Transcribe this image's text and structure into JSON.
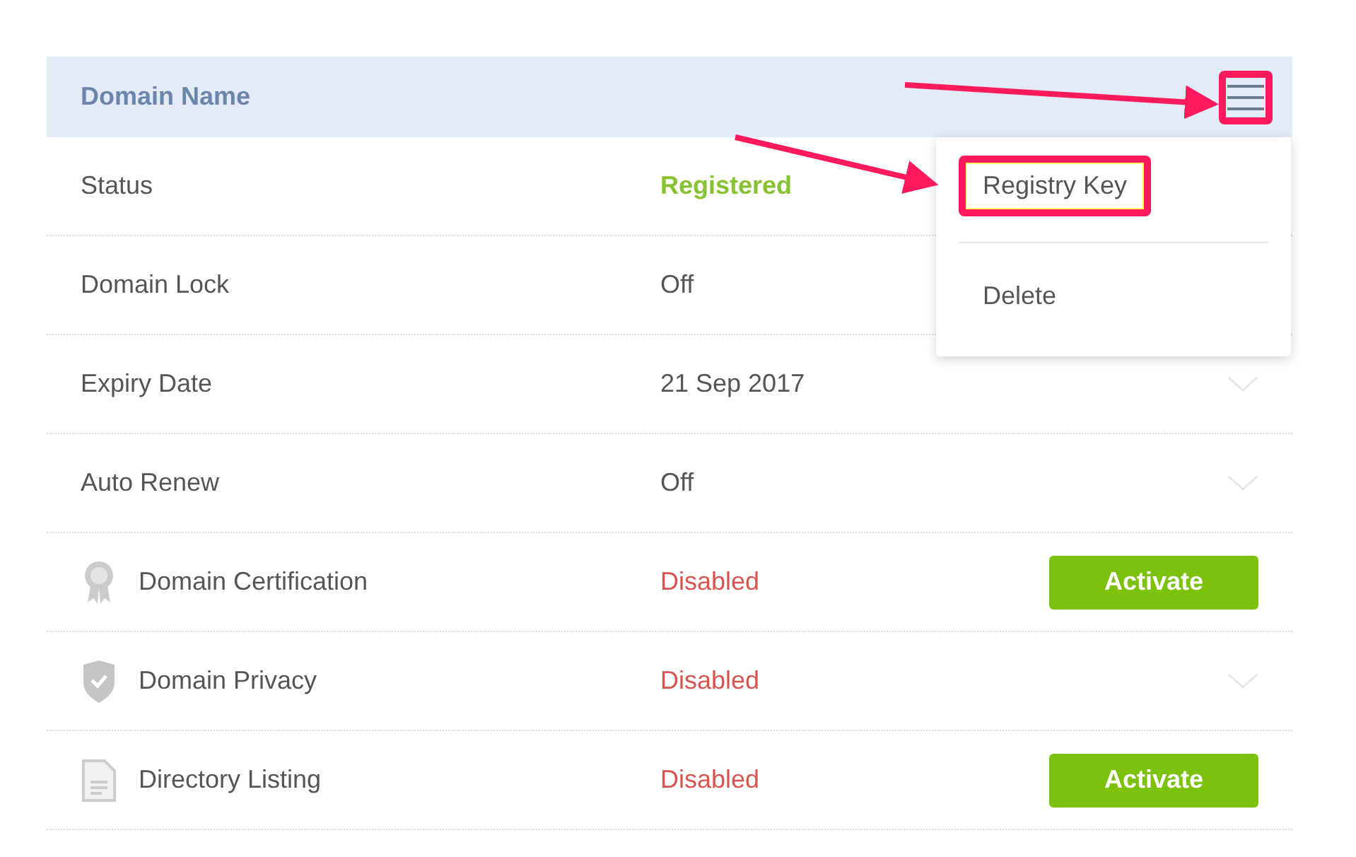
{
  "header": {
    "title": "Domain Name",
    "menu_button": {
      "highlighted": true
    }
  },
  "rows": [
    {
      "label": "Status",
      "kind": "plain",
      "value": {
        "text": "Registered",
        "kind": "good"
      },
      "action": {
        "kind": "none"
      }
    },
    {
      "label": "Domain Lock",
      "kind": "plain",
      "value": {
        "text": "Off",
        "kind": "plain"
      },
      "action": {
        "kind": "none"
      }
    },
    {
      "label": "Expiry Date",
      "kind": "plain",
      "value": {
        "text": "21 Sep 2017",
        "kind": "plain"
      },
      "action": {
        "kind": "chevron"
      }
    },
    {
      "label": "Auto Renew",
      "kind": "plain",
      "value": {
        "text": "Off",
        "kind": "plain"
      },
      "action": {
        "kind": "chevron"
      }
    },
    {
      "label": "Domain Certification",
      "kind": "certificate",
      "value": {
        "text": "Disabled",
        "kind": "bad"
      },
      "action": {
        "kind": "button",
        "label": "Activate"
      }
    },
    {
      "label": "Domain Privacy",
      "kind": "shield",
      "value": {
        "text": "Disabled",
        "kind": "bad"
      },
      "action": {
        "kind": "chevron"
      }
    },
    {
      "label": "Directory Listing",
      "kind": "document",
      "value": {
        "text": "Disabled",
        "kind": "bad"
      },
      "action": {
        "kind": "button",
        "label": "Activate"
      }
    }
  ],
  "menu": {
    "open": true,
    "items": [
      {
        "label": "Registry Key",
        "highlighted": true
      },
      {
        "label": "Delete",
        "highlighted": false
      }
    ]
  }
}
